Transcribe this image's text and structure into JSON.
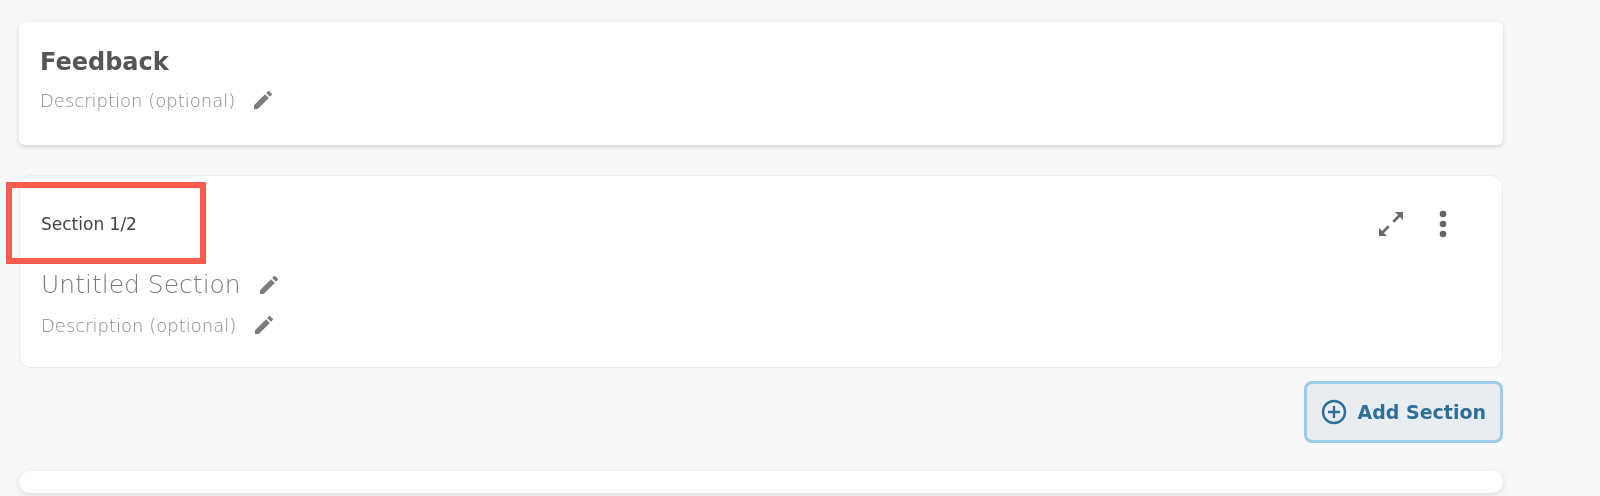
{
  "form_header": {
    "title": "Feedback",
    "description_placeholder": "Description (optional)"
  },
  "section": {
    "label": "Section 1/2",
    "label_highlighted": true,
    "title_placeholder": "Untitled Section",
    "description_placeholder": "Description (optional)"
  },
  "add_section_button": {
    "label": "Add Section"
  }
}
